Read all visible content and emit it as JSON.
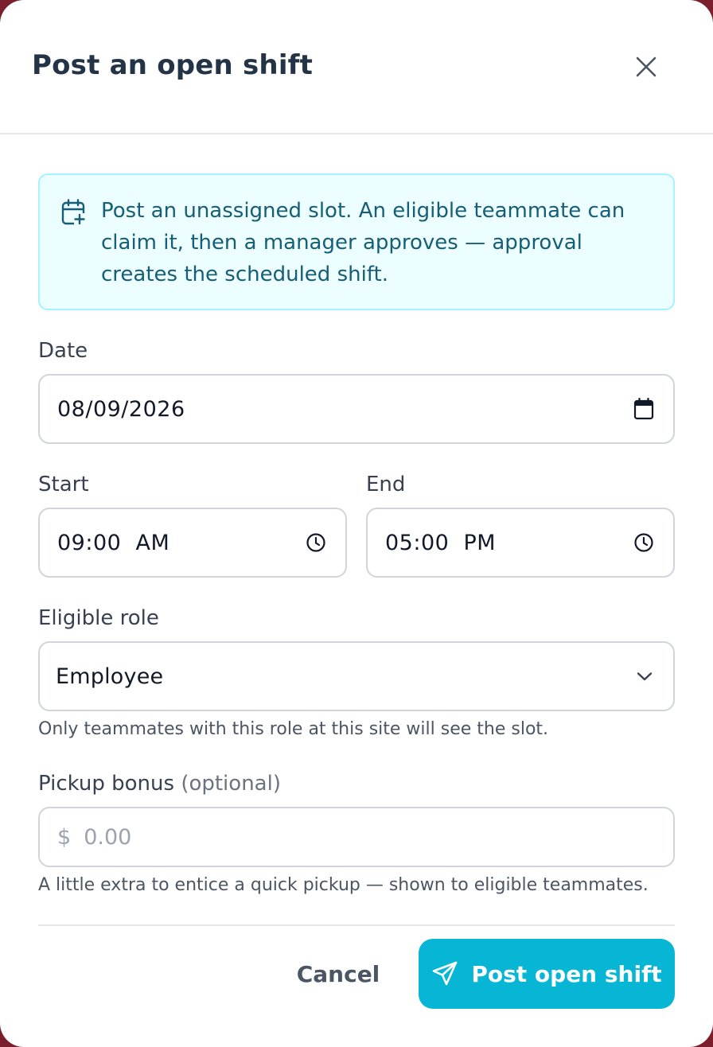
{
  "dialog": {
    "title": "Post an open shift",
    "close_icon": "close-icon"
  },
  "info": {
    "icon": "calendar-plus-icon",
    "text": "Post an unassigned slot. An eligible teammate can claim it, then a manager approves — approval creates the scheduled shift."
  },
  "date": {
    "label": "Date",
    "value": "08/09/2026",
    "icon": "calendar-icon"
  },
  "start": {
    "label": "Start",
    "value": "09:00  AM",
    "icon": "clock-icon"
  },
  "end": {
    "label": "End",
    "value": "05:00  PM",
    "icon": "clock-icon"
  },
  "role": {
    "label": "Eligible role",
    "value": "Employee",
    "icon": "chevron-down-icon",
    "help": "Only teammates with this role at this site will see the slot."
  },
  "bonus": {
    "label": "Pickup bonus",
    "label_suffix": "(optional)",
    "currency": "$",
    "placeholder": "0.00",
    "help": "A little extra to entice a quick pickup — shown to eligible teammates."
  },
  "actions": {
    "cancel_label": "Cancel",
    "submit_label": "Post open shift",
    "submit_icon": "send-icon"
  },
  "colors": {
    "accent": "#06b6d4",
    "info_bg": "#ecfeff",
    "info_text": "#155e75"
  }
}
